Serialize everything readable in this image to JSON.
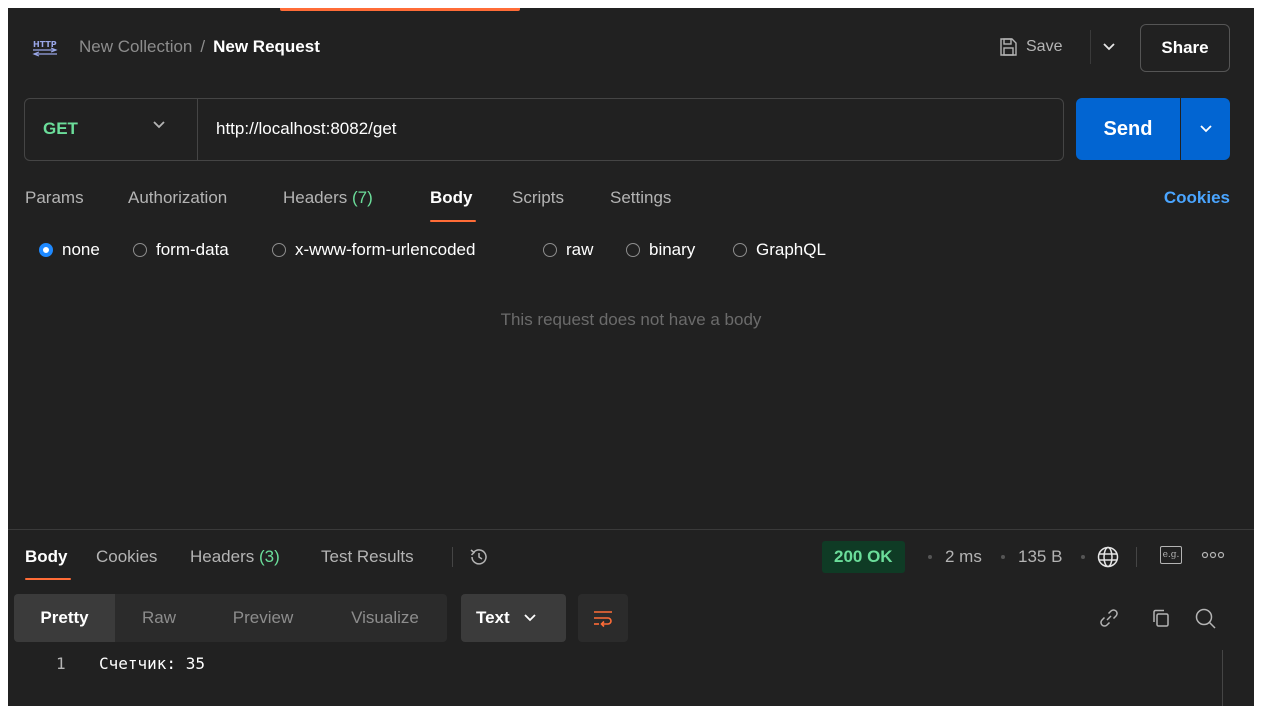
{
  "header": {
    "http_icon": "http-icon",
    "collection": "New Collection",
    "separator": "/",
    "request_name": "New Request",
    "save_label": "Save",
    "share_label": "Share"
  },
  "request": {
    "method": "GET",
    "url": "http://localhost:8082/get",
    "send_label": "Send"
  },
  "request_tabs": {
    "params": "Params",
    "authorization": "Authorization",
    "headers": "Headers",
    "headers_count": "(7)",
    "body": "Body",
    "scripts": "Scripts",
    "settings": "Settings",
    "cookies": "Cookies",
    "active": "Body"
  },
  "body_types": {
    "none": "none",
    "form_data": "form-data",
    "urlencoded": "x-www-form-urlencoded",
    "raw": "raw",
    "binary": "binary",
    "graphql": "GraphQL",
    "selected": "none"
  },
  "empty_body_message": "This request does not have a body",
  "response": {
    "tabs": {
      "body": "Body",
      "cookies": "Cookies",
      "headers": "Headers",
      "headers_count": "(3)",
      "test_results": "Test Results"
    },
    "status": "200 OK",
    "time": "2 ms",
    "size": "135 B",
    "eg_badge": "e.g.",
    "views": {
      "pretty": "Pretty",
      "raw": "Raw",
      "preview": "Preview",
      "visualize": "Visualize"
    },
    "format": "Text",
    "lines": [
      {
        "number": "1",
        "text": "Счетчик: 35"
      }
    ]
  },
  "colors": {
    "accent": "#ff6c37",
    "send": "#0265d2",
    "method": "#6bdd9a",
    "link": "#4aa5ff",
    "background": "#212121"
  }
}
